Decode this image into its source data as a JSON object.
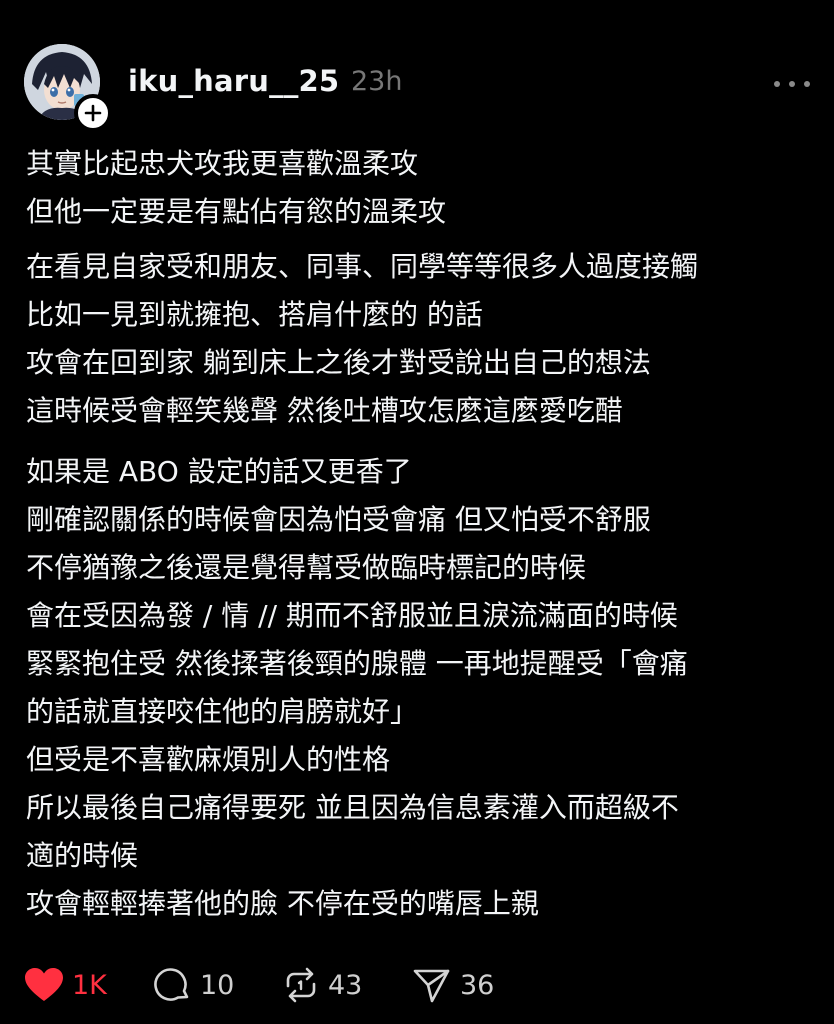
{
  "post": {
    "author": {
      "username": "iku_haru__25",
      "time_ago": "23h",
      "avatar_icon": "anime-avatar",
      "follow_icon": "plus-icon"
    },
    "more_icon": "more-horizontal-icon",
    "paragraphs": [
      [
        "其實比起忠犬攻我更喜歡溫柔攻",
        "但他一定要是有點佔有慾的溫柔攻"
      ],
      [
        "在看見自家受和朋友、同事、同學等等很多人過度接觸",
        "比如一見到就擁抱、搭肩什麼的 的話",
        "攻會在回到家 躺到床上之後才對受說出自己的想法",
        "這時候受會輕笑幾聲 然後吐槽攻怎麼這麼愛吃醋"
      ],
      [
        "如果是 ABO 設定的話又更香了",
        "剛確認關係的時候會因為怕受會痛 但又怕受不舒服",
        "不停猶豫之後還是覺得幫受做臨時標記的時候",
        "會在受因為發 / 情 // 期而不舒服並且淚流滿面的時候",
        "緊緊抱住受 然後揉著後頸的腺體 一再地提醒受「會痛",
        "的話就直接咬住他的肩膀就好」",
        "但受是不喜歡麻煩別人的性格",
        "所以最後自己痛得要死 並且因為信息素灌入而超級不",
        "適的時候",
        "攻會輕輕捧著他的臉 不停在受的嘴唇上親"
      ]
    ],
    "actions": {
      "like": {
        "icon": "heart-icon",
        "count": "1K",
        "liked": true,
        "color": "#ff3040"
      },
      "reply": {
        "icon": "comment-icon",
        "count": "10"
      },
      "repost": {
        "icon": "repost-icon",
        "count": "43"
      },
      "share": {
        "icon": "send-icon",
        "count": "36"
      }
    }
  },
  "colors": {
    "background": "#000000",
    "text": "#f3f5f7",
    "muted": "#777777",
    "like": "#ff3040"
  }
}
